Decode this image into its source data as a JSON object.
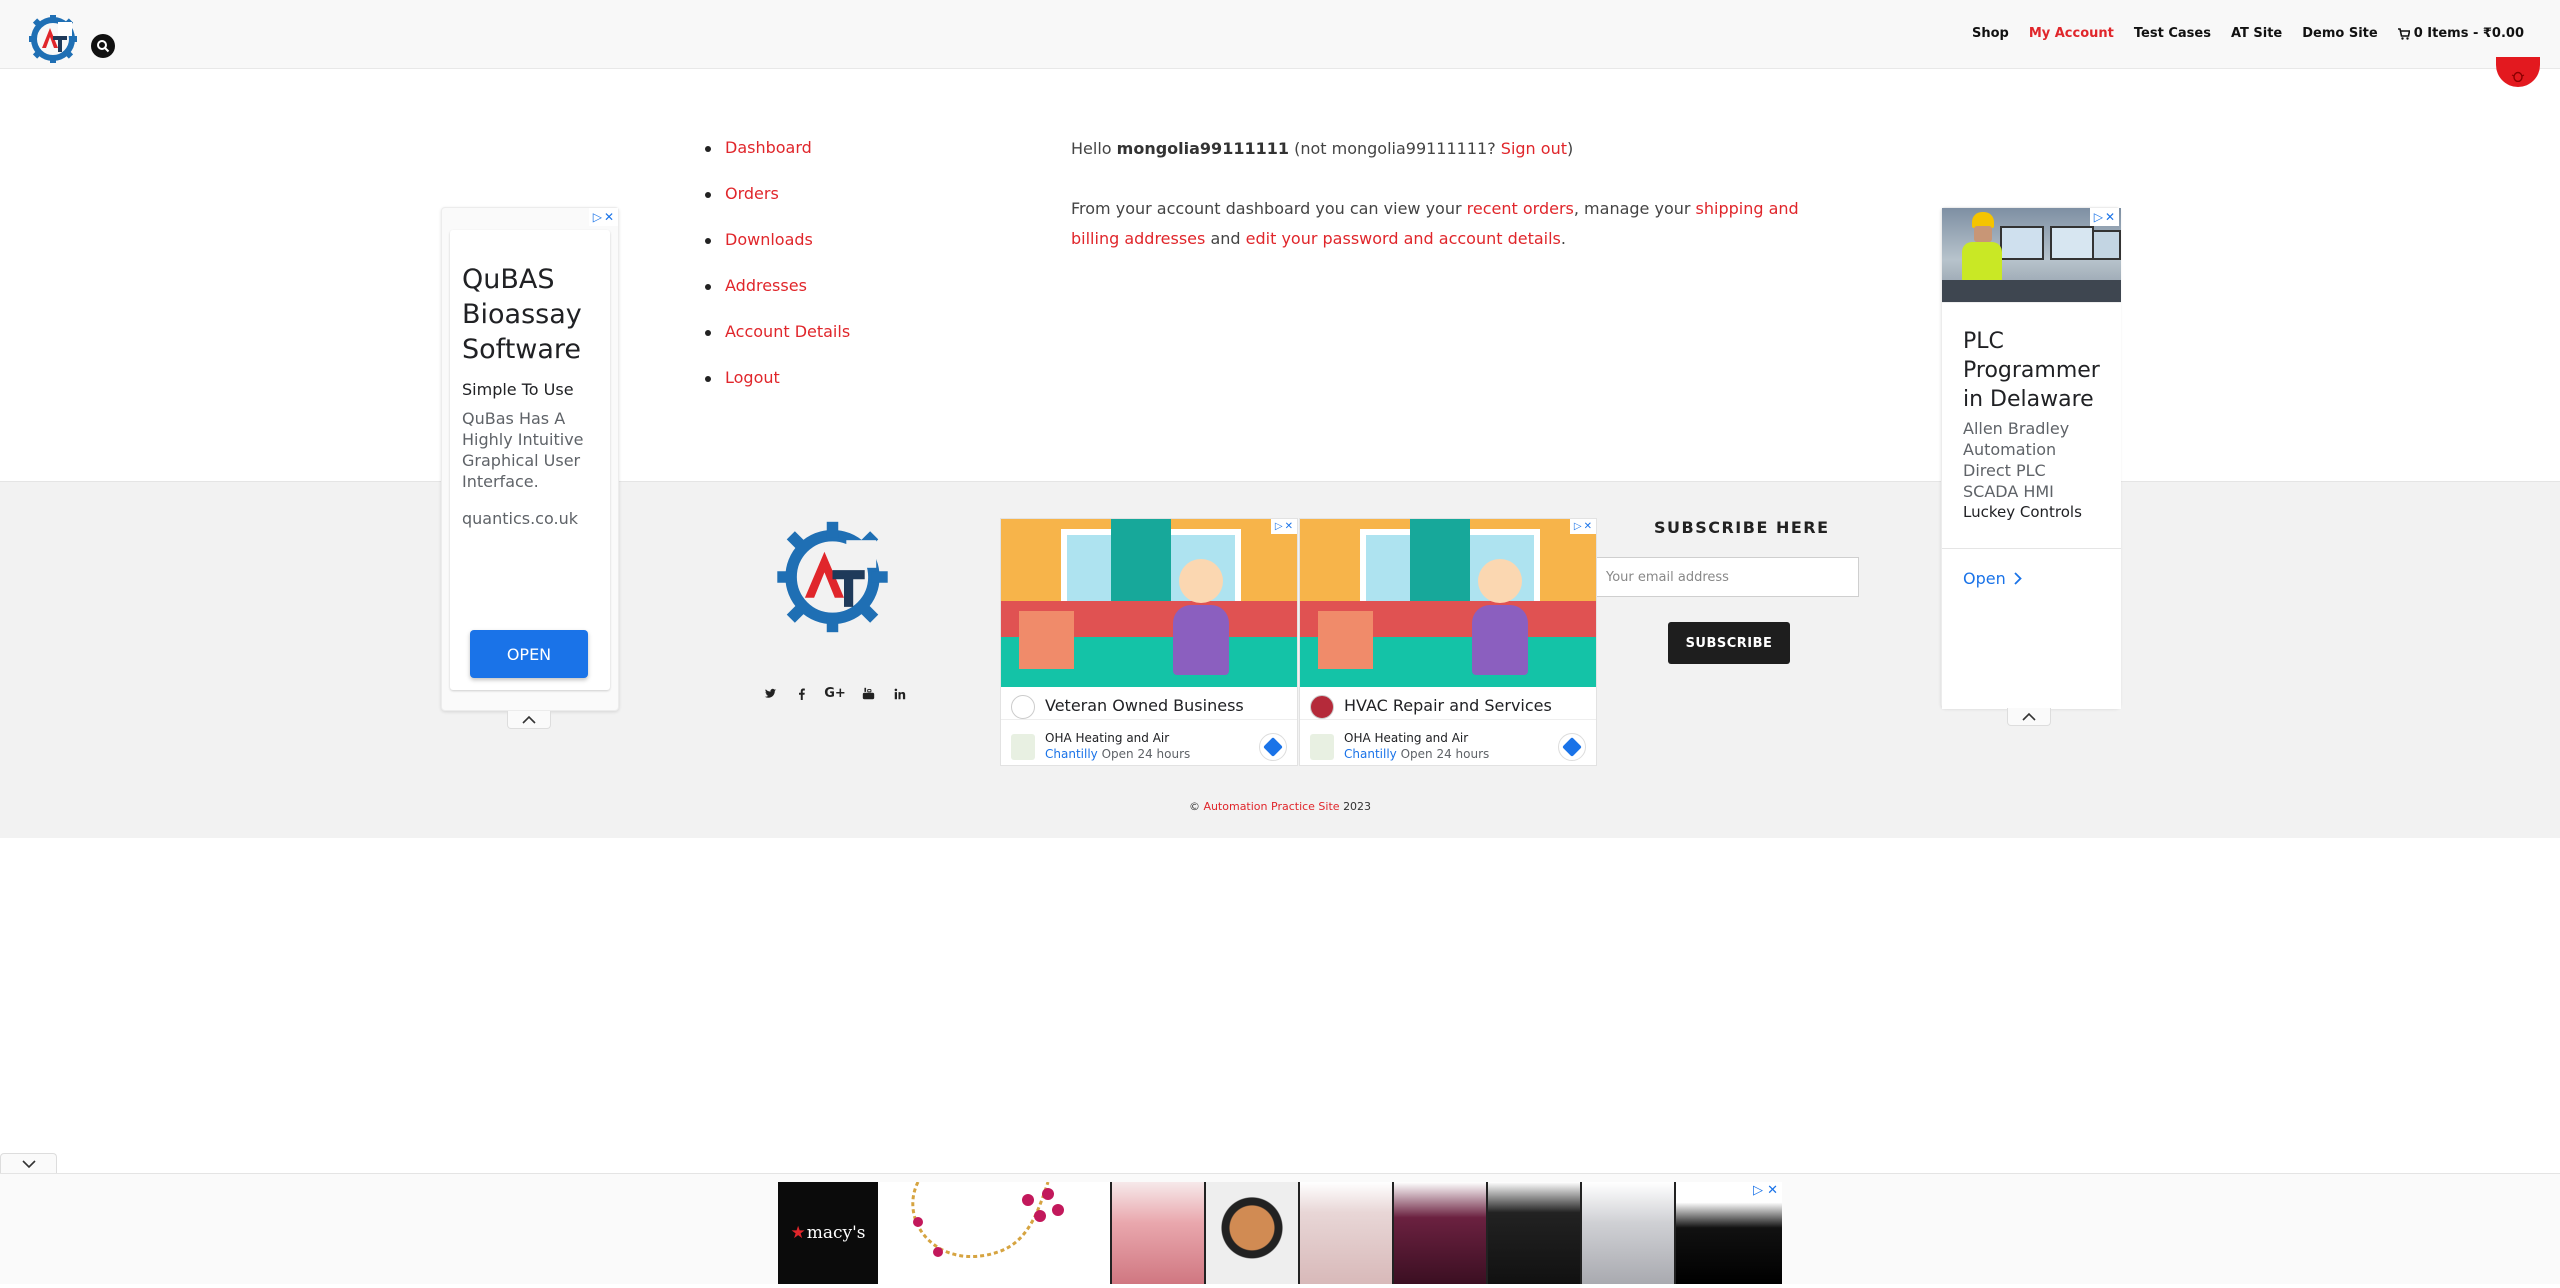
{
  "header": {
    "logo_text": "AT",
    "nav": [
      {
        "label": "Shop"
      },
      {
        "label": "My Account"
      },
      {
        "label": "Test Cases"
      },
      {
        "label": "AT Site"
      },
      {
        "label": "Demo Site"
      }
    ],
    "cart_label": "0 Items - ₹0.00"
  },
  "account": {
    "menu": [
      "Dashboard",
      "Orders",
      "Downloads",
      "Addresses",
      "Account Details",
      "Logout"
    ],
    "hello": "Hello",
    "username": "mongolia99111111",
    "not_user_prefix": "(not mongolia99111111?",
    "sign_out": "Sign out",
    "close_paren": ")",
    "intro": "From your account dashboard you can view your",
    "recent_orders": "recent orders",
    "manage": ", manage your",
    "addresses_link": "shipping and billing addresses",
    "and": "and",
    "password_link": "edit your password and account details",
    "period": "."
  },
  "ads": {
    "left": {
      "title": "QuBAS Bioassay Software",
      "subtitle": "Simple To Use",
      "body": "QuBas Has A Highly Intuitive Graphical User Interface.",
      "domain": "quantics.co.uk",
      "button": "OPEN"
    },
    "right": {
      "title": "PLC Programmer in Delaware",
      "body": "Allen Bradley Automation Direct PLC SCADA HMI",
      "company": "Luckey Controls",
      "open": "Open"
    },
    "mid": [
      {
        "title": "Veteran Owned Business",
        "biz": "OHA Heating and Air",
        "city": "Chantilly",
        "hours": "Open 24 hours"
      },
      {
        "title": "HVAC Repair and Services",
        "biz": "OHA Heating and Air",
        "city": "Chantilly",
        "hours": "Open 24 hours"
      }
    ],
    "bottom": {
      "brand": "macy's"
    }
  },
  "footer": {
    "subscribe_title": "SUBSCRIBE HERE",
    "email_placeholder": "Your email address",
    "subscribe_button": "SUBSCRIBE",
    "copyright_prefix": "©",
    "copyright_link": "Automation Practice Site",
    "copyright_year": "2023",
    "socials": [
      "twitter-icon",
      "facebook-icon",
      "google-plus-icon",
      "youtube-icon",
      "linkedin-icon"
    ]
  },
  "colors": {
    "accent": "#e0262b",
    "logo_blue": "#1f6fb4",
    "ad_blue": "#1a73e8"
  }
}
